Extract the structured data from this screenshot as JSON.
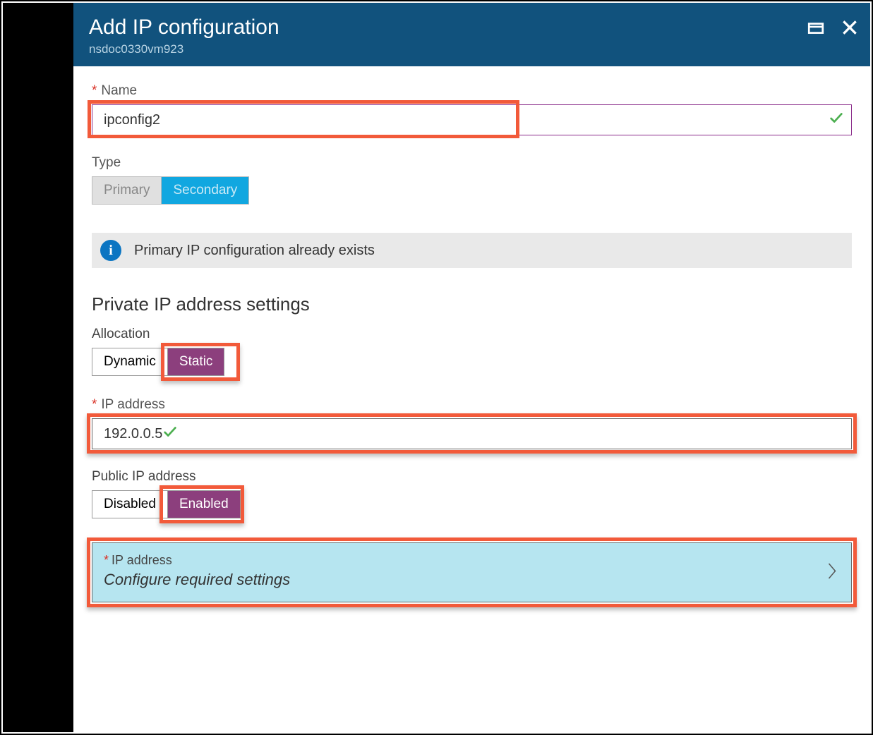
{
  "header": {
    "title": "Add IP configuration",
    "subtitle": "nsdoc0330vm923"
  },
  "nameField": {
    "label": "Name",
    "value": "ipconfig2"
  },
  "typeField": {
    "label": "Type",
    "options": {
      "primary": "Primary",
      "secondary": "Secondary"
    }
  },
  "infoBanner": "Primary IP configuration already exists",
  "privateSection": {
    "heading": "Private IP address settings",
    "allocation": {
      "label": "Allocation",
      "dynamic": "Dynamic",
      "static": "Static"
    },
    "ipAddress": {
      "label": "IP address",
      "value": "192.0.0.5"
    },
    "publicIp": {
      "label": "Public IP address",
      "disabled": "Disabled",
      "enabled": "Enabled"
    },
    "configure": {
      "label": "IP address",
      "sub": "Configure required settings"
    }
  }
}
